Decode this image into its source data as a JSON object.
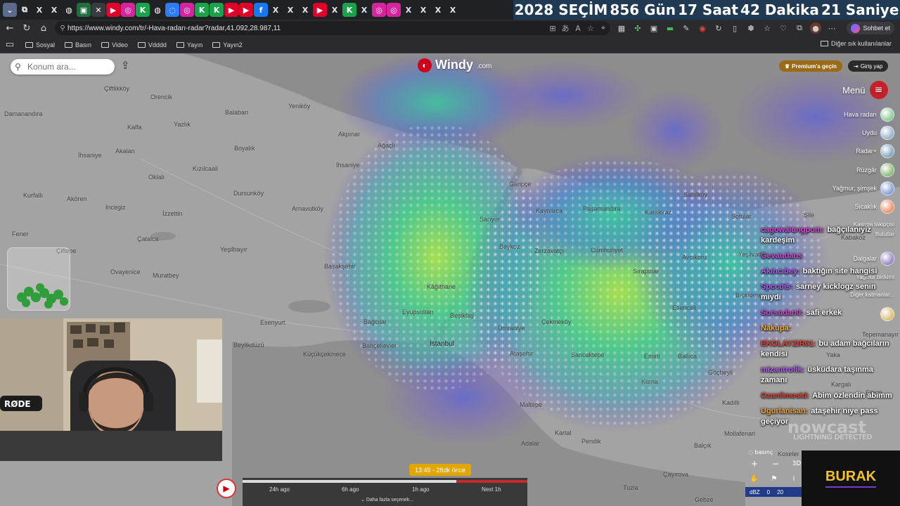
{
  "countdown": {
    "label": "2028 SEÇİM",
    "days": "856 Gün",
    "hours": "17 Saat",
    "minutes": "42 Dakika",
    "seconds": "21 Saniye"
  },
  "tabs": [
    {
      "icon": "tab-list-icon",
      "glyph": "⌄",
      "color": "#5b6b8a"
    },
    {
      "icon": "copy-icon",
      "glyph": "⧉",
      "color": "#3b3b3f"
    },
    {
      "icon": "x-icon",
      "glyph": "X",
      "color": "#000000"
    },
    {
      "icon": "x-icon",
      "glyph": "X",
      "color": "#000000"
    },
    {
      "icon": "globe-icon",
      "glyph": "◍",
      "color": "#3b3b3f"
    },
    {
      "icon": "windy-icon",
      "glyph": "▣",
      "color": "#1f6f3f"
    },
    {
      "icon": "close-icon",
      "glyph": "✕",
      "color": "#3b3b3f"
    },
    {
      "icon": "youtube-icon",
      "glyph": "▶",
      "color": "#e0002a"
    },
    {
      "icon": "instagram-icon",
      "glyph": "◎",
      "color": "#d6249f"
    },
    {
      "icon": "kick-icon",
      "glyph": "K",
      "color": "#1aa34a"
    },
    {
      "icon": "globe-icon",
      "glyph": "◍",
      "color": "#3b3b3f"
    },
    {
      "icon": "messenger-icon",
      "glyph": "◌",
      "color": "#2d7cf6"
    },
    {
      "icon": "instagram-icon",
      "glyph": "◎",
      "color": "#d6249f"
    },
    {
      "icon": "kick-icon",
      "glyph": "K",
      "color": "#1aa34a"
    },
    {
      "icon": "kick-icon",
      "glyph": "K",
      "color": "#1aa34a"
    },
    {
      "icon": "youtube-icon",
      "glyph": "▶",
      "color": "#e0002a"
    },
    {
      "icon": "youtube-icon",
      "glyph": "▶",
      "color": "#e0002a"
    },
    {
      "icon": "facebook-icon",
      "glyph": "f",
      "color": "#1877f2"
    },
    {
      "icon": "x-icon",
      "glyph": "X",
      "color": "#000000"
    },
    {
      "icon": "x-icon",
      "glyph": "X",
      "color": "#000000"
    },
    {
      "icon": "x-icon",
      "glyph": "X",
      "color": "#000000"
    },
    {
      "icon": "youtube-icon",
      "glyph": "▶",
      "color": "#e0002a"
    },
    {
      "icon": "x-icon",
      "glyph": "X",
      "color": "#000000"
    },
    {
      "icon": "kick-icon",
      "glyph": "K",
      "color": "#1aa34a"
    },
    {
      "icon": "x-icon",
      "glyph": "X",
      "color": "#000000"
    },
    {
      "icon": "instagram-icon",
      "glyph": "◎",
      "color": "#d6249f"
    },
    {
      "icon": "instagram-icon",
      "glyph": "◎",
      "color": "#d6249f"
    },
    {
      "icon": "x-icon",
      "glyph": "X",
      "color": "#000000"
    },
    {
      "icon": "x-icon",
      "glyph": "X",
      "color": "#000000"
    },
    {
      "icon": "x-icon",
      "glyph": "X",
      "color": "#000000"
    },
    {
      "icon": "x-icon",
      "glyph": "X",
      "color": "#000000"
    }
  ],
  "address": {
    "url": "https://www.windy.com/tr/-Hava-radarı-radar?radar,41.092,28.987,11"
  },
  "chat_button": "Sohbet et",
  "bookmarks": {
    "items": [
      "Sosyal",
      "Basın",
      "Video",
      "Vdddd",
      "Yayın",
      "Yayın2"
    ],
    "other": "Diğer sık kullanılanlar"
  },
  "windy": {
    "search_placeholder": "Konum ara...",
    "logo": "Windy",
    "logo_suffix": ".com",
    "premium": "Premium'a geçin",
    "login": "Giriş yap",
    "menu": "Menü",
    "layers": [
      {
        "label": "Hava radarı",
        "color": "#5bb56a"
      },
      {
        "label": "Uydu",
        "color": "#6d8fb3"
      },
      {
        "label": "Radar+",
        "color": "#4e7ea0"
      },
      {
        "label": "Rüzgâr",
        "color": "#5a9d3a"
      },
      {
        "label": "Yağmur, şimşek",
        "color": "#4a78c0"
      },
      {
        "label": "Sıcaklık",
        "color": "#e0602a"
      },
      {
        "label": "Kasırga takipçisi",
        "color": "#8a8a8a"
      },
      {
        "label": "Bulutlar",
        "color": "#9aa3ad"
      },
      {
        "label": "Dalgalar",
        "color": "#6a4fa8"
      },
      {
        "label": "Yağmur birikimi",
        "color": "#d3692b"
      },
      {
        "label": "Diğer katmanlar...",
        "color": "#7a7a7a"
      },
      {
        "label": "",
        "color": "#c9a23a"
      }
    ]
  },
  "places": [
    {
      "name": "Çiftlikköy"
    },
    {
      "name": "Orencik"
    },
    {
      "name": "Balaban"
    },
    {
      "name": "Yeniköy"
    },
    {
      "name": "Damanandıra"
    },
    {
      "name": "Kalfa"
    },
    {
      "name": "Yazlık"
    },
    {
      "name": "Boyalık"
    },
    {
      "name": "Akpınar"
    },
    {
      "name": "Ağaçlı"
    },
    {
      "name": "İhsaniye"
    },
    {
      "name": "Akalan"
    },
    {
      "name": "İhsaniye"
    },
    {
      "name": "Kızılcaali"
    },
    {
      "name": "Oklalı"
    },
    {
      "name": "Garipçe"
    },
    {
      "name": "Sahilköy"
    },
    {
      "name": "Kurfallı"
    },
    {
      "name": "Akören"
    },
    {
      "name": "İncegiz"
    },
    {
      "name": "Dursunköy"
    },
    {
      "name": "Kaynarca"
    },
    {
      "name": "Paşamandıra"
    },
    {
      "name": "Karakiraz"
    },
    {
      "name": "Sofular"
    },
    {
      "name": "Şile"
    },
    {
      "name": "İzzettin"
    },
    {
      "name": "Arnavutköy"
    },
    {
      "name": "Sarıyer"
    },
    {
      "name": "Fener"
    },
    {
      "name": "Çatalca"
    },
    {
      "name": "Beykoz"
    },
    {
      "name": "Zerzavatçı"
    },
    {
      "name": "Cumhuriyet"
    },
    {
      "name": "Kabakoz"
    },
    {
      "name": "Çiftepe"
    },
    {
      "name": "Yeşilbayır"
    },
    {
      "name": "Avcıkoru"
    },
    {
      "name": "Yeşilvadi"
    },
    {
      "name": "Ovayenice"
    },
    {
      "name": "Başakşehir"
    },
    {
      "name": "Sırapınar"
    },
    {
      "name": "Muratbey"
    },
    {
      "name": "Kâğıthane"
    },
    {
      "name": "Bıçkidere"
    },
    {
      "name": "Esenceli"
    },
    {
      "name": "Eyüpsultan"
    },
    {
      "name": "Beşiktaş"
    },
    {
      "name": "Esenyurt"
    },
    {
      "name": "Bağcılar"
    },
    {
      "name": "Çekmeköy"
    },
    {
      "name": "Ümraniye"
    },
    {
      "name": "İstanbul"
    },
    {
      "name": "Beylikdüzü"
    },
    {
      "name": "Bahçelievler"
    },
    {
      "name": "Ataşehir"
    },
    {
      "name": "Sancaktepe"
    },
    {
      "name": "Küçükçekmece"
    },
    {
      "name": "Emirli"
    },
    {
      "name": "Ballıca"
    },
    {
      "name": "Göçbeyli"
    },
    {
      "name": "Kurna"
    },
    {
      "name": "Yaka"
    },
    {
      "name": "Kargalı"
    },
    {
      "name": "Elbizli"
    },
    {
      "name": "Maltepe"
    },
    {
      "name": "Kadıllı"
    },
    {
      "name": "Kartal"
    },
    {
      "name": "Pendik"
    },
    {
      "name": "Adalar"
    },
    {
      "name": "Mollafenari"
    },
    {
      "name": "Balçık"
    },
    {
      "name": "Çayırova"
    },
    {
      "name": "Tuzla"
    },
    {
      "name": "Gebze"
    },
    {
      "name": "Koseler"
    },
    {
      "name": "Tepemanayır"
    }
  ],
  "chat": [
    {
      "user": "cagowalungpom:",
      "text": "bağçılanıyiz kardeşim",
      "color": "#d24bd6"
    },
    {
      "user": "Gevaudans",
      "text": "",
      "color": "#d24bd6"
    },
    {
      "user": "Akıncıbey:",
      "text": "baktığın site hangisi",
      "color": "#b45cf0"
    },
    {
      "user": "Spccdis:",
      "text": "sarney kicklogz senin miydi",
      "color": "#b45cf0"
    },
    {
      "user": "Sorsudan0:",
      "text": "safi erkek",
      "color": "#d24bd6"
    },
    {
      "user": "Nakupa:",
      "text": "",
      "color": "#f2b23a"
    },
    {
      "user": "EKOLAYZIR61:",
      "text": "bu adam bağcıların kendisi",
      "color": "#e0443a"
    },
    {
      "user": "mizantrofik:",
      "text": "üsküdara taşınma zamanı",
      "color": "#b45cf0"
    },
    {
      "user": "Ozanlimosid:",
      "text": "Abim özlendin abimm",
      "color": "#e0443a"
    },
    {
      "user": "Ugurlanisan:",
      "text": "ataşehir niye pass geçiyor",
      "color": "#f2a23a"
    }
  ],
  "radar_overlay": {
    "lightning": "LIGHTNING DETECTED",
    "brand_faint": "nowcast"
  },
  "zoom": {
    "plus": "+",
    "minus": "−",
    "mode": "3D",
    "basinc": "basınç",
    "dbz": "dBZ",
    "dbz_values": [
      "0",
      "20"
    ]
  },
  "streamer": {
    "name": "BURAK"
  },
  "timeline": {
    "bubble": "13:49 - 28dk önce",
    "labels": [
      "24h ago",
      "6h ago",
      "1h ago",
      "Next 1h"
    ],
    "more": "Daha fazla seçenek...",
    "progress": 0.75
  }
}
